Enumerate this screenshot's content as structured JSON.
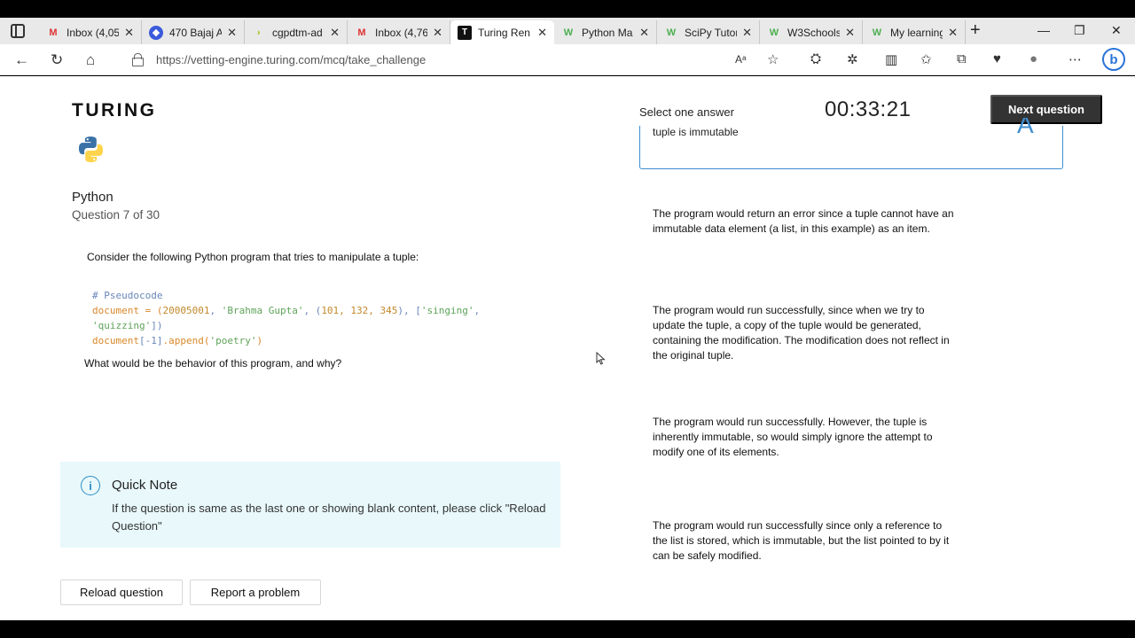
{
  "browser": {
    "tabs": [
      {
        "label": "Inbox (4,05",
        "icon": "gmail-icon"
      },
      {
        "label": "470 Bajaj A",
        "icon": "app-icon"
      },
      {
        "label": "cgpdtm-ad",
        "icon": "leaf-icon"
      },
      {
        "label": "Inbox (4,76",
        "icon": "gmail-icon"
      },
      {
        "label": "Turing Ren",
        "icon": "turing-icon"
      },
      {
        "label": "Python Ma",
        "icon": "w3schools-icon"
      },
      {
        "label": "SciPy Tutor",
        "icon": "w3schools-icon"
      },
      {
        "label": "W3Schools",
        "icon": "w3schools-icon"
      },
      {
        "label": "My learning",
        "icon": "w3schools-icon"
      }
    ],
    "close_glyph": "✕",
    "new_tab_glyph": "+",
    "url": "https://vetting-engine.turing.com/mcq/take_challenge",
    "reader_glyph": "Aᵃ"
  },
  "page": {
    "logo": "TURING",
    "language": "Python",
    "question_number": "Question 7 of 30",
    "question_intro": "Consider the following Python program that tries to manipulate a tuple:",
    "code": {
      "line1": "# Pseudocode",
      "line2_var": "document = (",
      "line2_num": "20005001",
      "line2_sep1": ", ",
      "line2_str": "'Brahma Gupta'",
      "line2_sep2": ", (",
      "line2_nums": "101, 132, 345",
      "line2_sep3": "), [",
      "line2_str2": "'singing'",
      "line2_sep4": ",",
      "line3_str": "'quizzing'",
      "line3_end": "])",
      "line4_var": "document",
      "line4_idx": "[-1]",
      "line4_call": ".append(",
      "line4_str": "'poetry'",
      "line4_end": ")"
    },
    "question_prompt": "What would be the behavior of this program, and why?",
    "note": {
      "title": "Quick Note",
      "body": "If the question is same as the last one or showing blank content, please click \"Reload Question\""
    },
    "buttons": {
      "reload": "Reload question",
      "report": "Report a problem",
      "next": "Next question"
    },
    "select_label": "Select one answer",
    "timer": "00:33:21",
    "options": [
      "tuple is immutable",
      "The program would return an error since a tuple cannot have an immutable data element (a list, in this example) as an item.",
      "The program would run successfully, since when we try to update the tuple, a copy of the tuple would be generated, containing the modification. The modification does not reflect in the original tuple.",
      "The program would run successfully. However, the tuple is inherently immutable, so would simply ignore the attempt to modify one of its elements.",
      "The program would run successfully since only a reference to the list is stored, which is immutable, but the list pointed to by it can be safely modified."
    ],
    "option_letter": "A",
    "info_glyph": "i"
  },
  "colors": {
    "accent": "#3e8ed0",
    "note_bg": "#e8f8fb",
    "next_btn_bg": "#333333"
  }
}
